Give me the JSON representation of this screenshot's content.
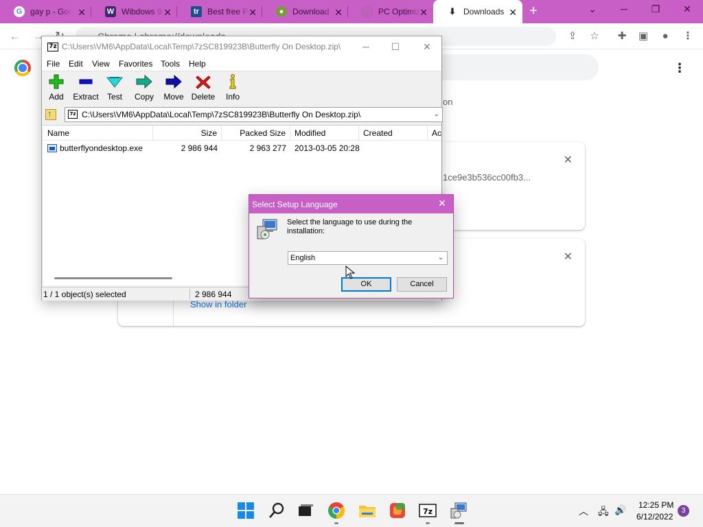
{
  "browser": {
    "tabs": [
      {
        "label": "gay p - Goo",
        "icon": "google-g-icon"
      },
      {
        "label": "Wibdows 9",
        "icon": "site-icon"
      },
      {
        "label": "Best free Pc",
        "icon": "tr-icon"
      },
      {
        "label": "Download",
        "icon": "site-icon"
      },
      {
        "label": "PC Optimiz",
        "icon": "globe-icon"
      },
      {
        "label": "Downloads",
        "icon": "download-icon",
        "active": true
      }
    ],
    "new_tab": "+",
    "address": "Chrome | chrome://downloads"
  },
  "downloads_page": {
    "partial_text": "on",
    "card1_hash": "1ce9e3b536cc00fb3...",
    "card2_link": "Show in folder"
  },
  "sevenzip": {
    "title": "C:\\Users\\VM6\\AppData\\Local\\Temp\\7zSC819923B\\Butterfly On Desktop.zip\\",
    "menu": [
      "File",
      "Edit",
      "View",
      "Favorites",
      "Tools",
      "Help"
    ],
    "toolbar": [
      "Add",
      "Extract",
      "Test",
      "Copy",
      "Move",
      "Delete",
      "Info"
    ],
    "address": "C:\\Users\\VM6\\AppData\\Local\\Temp\\7zSC819923B\\Butterfly On Desktop.zip\\",
    "columns": [
      "Name",
      "Size",
      "Packed Size",
      "Modified",
      "Created",
      "Ac"
    ],
    "rows": [
      {
        "name": "butterflyondesktop.exe",
        "size": "2 986 944",
        "packed": "2 963 277",
        "modified": "2013-03-05 20:28",
        "created": ""
      }
    ],
    "status": {
      "selected": "1 / 1 object(s) selected",
      "size": "2 986 944"
    }
  },
  "dialog": {
    "title": "Select Setup Language",
    "message": "Select the language to use during the installation:",
    "language": "English",
    "ok": "OK",
    "cancel": "Cancel"
  },
  "taskbar": {
    "time": "12:25 PM",
    "date": "6/12/2022",
    "notifications": "3"
  },
  "colors": {
    "chrome_theme": "#c85fc6",
    "dialog_title": "#c85fc6",
    "link": "#1a73e8"
  }
}
